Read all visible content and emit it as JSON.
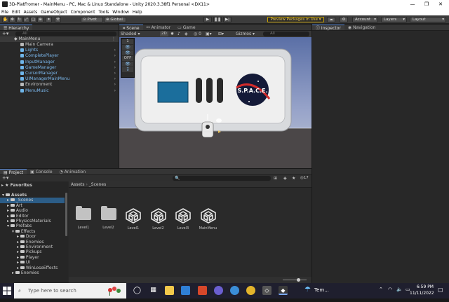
{
  "window": {
    "title": "3D-PlatFromer - MainMenu - PC, Mac & Linux Standalone - Unity 2020.3.38f1 Personal <DX11>",
    "controls": [
      "—",
      "❐",
      "✕"
    ]
  },
  "menubar": [
    "File",
    "Edit",
    "Assets",
    "GameObject",
    "Component",
    "Tools",
    "Window",
    "Help"
  ],
  "toolbar": {
    "pivot": "Pivot",
    "global": "Global",
    "preview_packages": "Preview Packages in Use",
    "account": "Account",
    "layers": "Layers",
    "layout": "Layout"
  },
  "hierarchy": {
    "tab": "Hierarchy",
    "search_placeholder": "All",
    "scene": "MainMenu",
    "items": [
      {
        "name": "Main Camera",
        "prefab": false,
        "arrow": false
      },
      {
        "name": "Lights",
        "prefab": true,
        "arrow": true
      },
      {
        "name": "CompletePlayer",
        "prefab": true,
        "arrow": true
      },
      {
        "name": "InputManager",
        "prefab": true,
        "arrow": true
      },
      {
        "name": "GameManager",
        "prefab": true,
        "arrow": true
      },
      {
        "name": "CursorManager",
        "prefab": true,
        "arrow": true
      },
      {
        "name": "UIManagerMainMenu",
        "prefab": true,
        "arrow": true
      },
      {
        "name": "Environment",
        "prefab": false,
        "arrow": true
      },
      {
        "name": "MenuMusic",
        "prefab": true,
        "arrow": true
      }
    ]
  },
  "scene_view": {
    "tabs": [
      "Scene",
      "Animator",
      "Game"
    ],
    "shading": "Shaded",
    "mode_2d": "2D",
    "gizmos": "Gizmos",
    "search_placeholder": "All",
    "overlay": [
      "1",
      "OFF"
    ],
    "logo_text": "S.P.A.C.E."
  },
  "inspector": {
    "tabs": [
      "Inspector",
      "Navigation"
    ]
  },
  "project": {
    "tabs": [
      "Project",
      "Console",
      "Animation"
    ],
    "favorites": "Favorites",
    "breadcrumb": [
      "Assets",
      "_Scenes"
    ],
    "count": "17",
    "tree": [
      {
        "name": "Assets",
        "level": 0,
        "open": true
      },
      {
        "name": "_Scenes",
        "level": 1,
        "selected": true
      },
      {
        "name": "Art",
        "level": 1
      },
      {
        "name": "Audio",
        "level": 1
      },
      {
        "name": "Editor",
        "level": 1
      },
      {
        "name": "PhysicsMaterials",
        "level": 1
      },
      {
        "name": "Prefabs",
        "level": 1,
        "open": true
      },
      {
        "name": "Effects",
        "level": 2,
        "open": true
      },
      {
        "name": "Door",
        "level": 3
      },
      {
        "name": "Enemies",
        "level": 3
      },
      {
        "name": "Environment",
        "level": 3
      },
      {
        "name": "Pickups",
        "level": 3
      },
      {
        "name": "Player",
        "level": 3
      },
      {
        "name": "UI",
        "level": 3
      },
      {
        "name": "WinLoseEffects",
        "level": 3
      },
      {
        "name": "Enemies",
        "level": 2
      }
    ],
    "assets": [
      {
        "name": "Level1",
        "kind": "folder"
      },
      {
        "name": "Level2",
        "kind": "folder"
      },
      {
        "name": "Level1",
        "kind": "scene"
      },
      {
        "name": "Level2",
        "kind": "scene"
      },
      {
        "name": "Level3",
        "kind": "scene"
      },
      {
        "name": "MainMenu",
        "kind": "scene"
      }
    ]
  },
  "taskbar": {
    "search_placeholder": "Type here to search",
    "weather": "Tem...",
    "time": "6:59 PM",
    "date": "11/11/2022"
  },
  "colors": {
    "accent": "#5a8ad8",
    "preview": "#e9c34a",
    "prefab_text": "#7cb9ee",
    "selection": "#2c5d87"
  }
}
